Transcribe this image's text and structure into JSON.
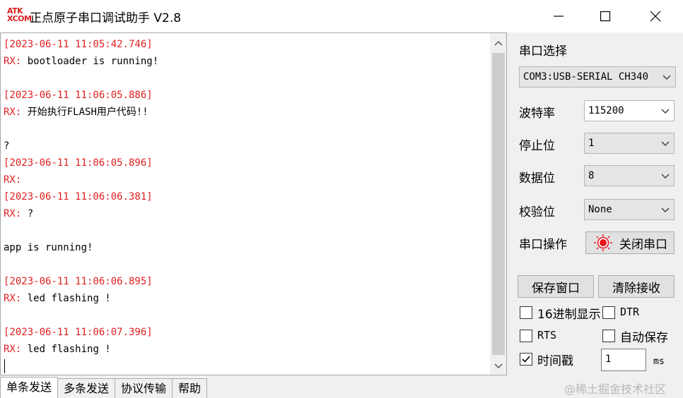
{
  "window": {
    "logo_top": "ATK",
    "logo_bottom": "XCOM",
    "title": "正点原子串口调试助手 V2.8",
    "minimize_icon": "minimize-icon",
    "maximize_icon": "maximize-icon",
    "close_icon": "close-icon"
  },
  "receive": {
    "lines": [
      {
        "text": "[2023-06-11 11:05:42.746]",
        "color": "red"
      },
      {
        "text": "RX: bootloader is running!",
        "color": "mixed",
        "prefix": "RX:",
        "rest": " bootloader is running!"
      },
      {
        "text": "",
        "color": "black"
      },
      {
        "text": "[2023-06-11 11:06:05.886]",
        "color": "red"
      },
      {
        "text": "RX: 开始执行FLASH用户代码!!",
        "color": "mixed",
        "prefix": "RX:",
        "rest": " 开始执行FLASH用户代码!!"
      },
      {
        "text": "",
        "color": "black"
      },
      {
        "text": "?",
        "color": "black"
      },
      {
        "text": "[2023-06-11 11:06:05.896]",
        "color": "red"
      },
      {
        "text": "RX:",
        "color": "mixed",
        "prefix": "RX:",
        "rest": ""
      },
      {
        "text": "[2023-06-11 11:06:06.381]",
        "color": "red"
      },
      {
        "text": "RX: ?",
        "color": "mixed",
        "prefix": "RX:",
        "rest": " ?"
      },
      {
        "text": "",
        "color": "black"
      },
      {
        "text": "app is running!",
        "color": "black"
      },
      {
        "text": "",
        "color": "black"
      },
      {
        "text": "[2023-06-11 11:06:06.895]",
        "color": "red"
      },
      {
        "text": "RX: led flashing !",
        "color": "mixed",
        "prefix": "RX:",
        "rest": " led flashing !"
      },
      {
        "text": "",
        "color": "black"
      },
      {
        "text": "[2023-06-11 11:06:07.396]",
        "color": "red"
      },
      {
        "text": "RX: led flashing !",
        "color": "mixed",
        "prefix": "RX:",
        "rest": " led flashing !"
      }
    ]
  },
  "tabs": [
    {
      "label": "单条发送",
      "active": true
    },
    {
      "label": "多条发送",
      "active": false
    },
    {
      "label": "协议传输",
      "active": false
    },
    {
      "label": "帮助",
      "active": false
    }
  ],
  "panel": {
    "port_select_label": "串口选择",
    "port_value": "COM3:USB-SERIAL CH340",
    "baud_label": "波特率",
    "baud_value": "115200",
    "stop_label": "停止位",
    "stop_value": "1",
    "data_label": "数据位",
    "data_value": "8",
    "parity_label": "校验位",
    "parity_value": "None",
    "port_op_label": "串口操作",
    "close_port_button": "关闭串口",
    "save_window_button": "保存窗口",
    "clear_receive_button": "清除接收",
    "hex_display_label": "16进制显示",
    "hex_display_checked": false,
    "dtr_label": "DTR",
    "dtr_checked": false,
    "rts_label": "RTS",
    "rts_checked": false,
    "auto_save_label": "自动保存",
    "auto_save_checked": false,
    "timestamp_label": "时间戳",
    "timestamp_checked": true,
    "interval_value": "1",
    "interval_unit": "ms"
  },
  "watermark": "@稀土掘金技术社区",
  "colors": {
    "rx_red": "#e01f1f",
    "indicator_red": "#e8141e"
  }
}
